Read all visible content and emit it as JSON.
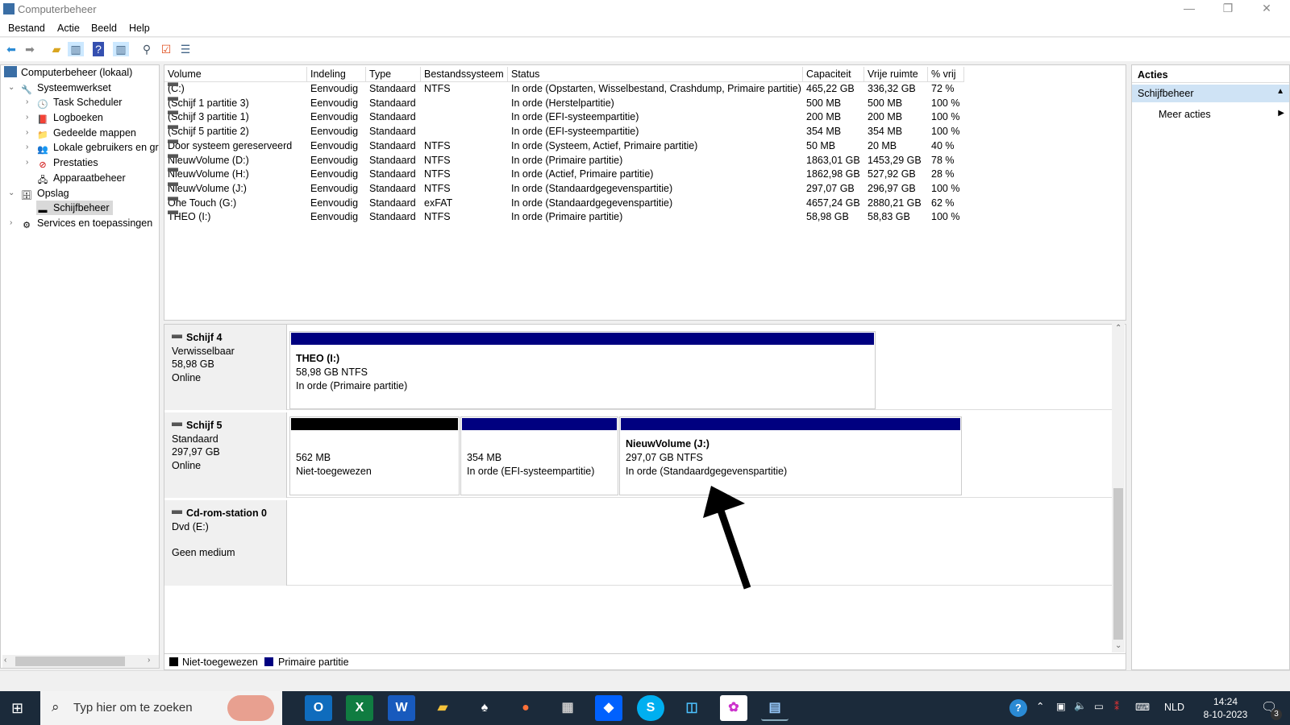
{
  "window": {
    "title": "Computerbeheer",
    "minimize": "—",
    "restore": "❐",
    "close": "✕"
  },
  "menu": [
    "Bestand",
    "Actie",
    "Beeld",
    "Help"
  ],
  "tree": {
    "root": "Computerbeheer (lokaal)",
    "items": [
      "Systeemwerkset",
      "Task Scheduler",
      "Logboeken",
      "Gedeelde mappen",
      "Lokale gebruikers en groepen",
      "Prestaties",
      "Apparaatbeheer",
      "Opslag",
      "Schijfbeheer",
      "Services en toepassingen"
    ]
  },
  "table": {
    "headers": [
      "Volume",
      "Indeling",
      "Type",
      "Bestandssysteem",
      "Status",
      "Capaciteit",
      "Vrije ruimte",
      "% vrij"
    ],
    "rows": [
      [
        "(C:)",
        "Eenvoudig",
        "Standaard",
        "NTFS",
        "In orde (Opstarten, Wisselbestand, Crashdump, Primaire partitie)",
        "465,22 GB",
        "336,32 GB",
        "72 %"
      ],
      [
        "(Schijf 1 partitie 3)",
        "Eenvoudig",
        "Standaard",
        "",
        "In orde (Herstelpartitie)",
        "500 MB",
        "500 MB",
        "100 %"
      ],
      [
        "(Schijf 3 partitie 1)",
        "Eenvoudig",
        "Standaard",
        "",
        "In orde (EFI-systeempartitie)",
        "200 MB",
        "200 MB",
        "100 %"
      ],
      [
        "(Schijf 5 partitie 2)",
        "Eenvoudig",
        "Standaard",
        "",
        "In orde (EFI-systeempartitie)",
        "354 MB",
        "354 MB",
        "100 %"
      ],
      [
        "Door systeem gereserveerd",
        "Eenvoudig",
        "Standaard",
        "NTFS",
        "In orde (Systeem, Actief, Primaire partitie)",
        "50 MB",
        "20 MB",
        "40 %"
      ],
      [
        "NieuwVolume (D:)",
        "Eenvoudig",
        "Standaard",
        "NTFS",
        "In orde (Primaire partitie)",
        "1863,01 GB",
        "1453,29 GB",
        "78 %"
      ],
      [
        "NieuwVolume (H:)",
        "Eenvoudig",
        "Standaard",
        "NTFS",
        "In orde (Actief, Primaire partitie)",
        "1862,98 GB",
        "527,92 GB",
        "28 %"
      ],
      [
        "NieuwVolume (J:)",
        "Eenvoudig",
        "Standaard",
        "NTFS",
        "In orde (Standaardgegevenspartitie)",
        "297,07 GB",
        "296,97 GB",
        "100 %"
      ],
      [
        "One Touch (G:)",
        "Eenvoudig",
        "Standaard",
        "exFAT",
        "In orde (Standaardgegevenspartitie)",
        "4657,24 GB",
        "2880,21 GB",
        "62 %"
      ],
      [
        "THEO (I:)",
        "Eenvoudig",
        "Standaard",
        "NTFS",
        "In orde (Primaire partitie)",
        "58,98 GB",
        "58,83 GB",
        "100 %"
      ]
    ]
  },
  "disks": [
    {
      "name": "Schijf 4",
      "type": "Verwisselbaar",
      "size": "58,98 GB",
      "state": "Online",
      "parts": [
        {
          "title": "THEO  (I:)",
          "line1": "58,98 GB NTFS",
          "line2": "In orde (Primaire partitie)"
        }
      ]
    },
    {
      "name": "Schijf 5",
      "type": "Standaard",
      "size": "297,97 GB",
      "state": "Online",
      "parts": [
        {
          "title": "",
          "line1": "562 MB",
          "line2": "Niet-toegewezen"
        },
        {
          "title": "",
          "line1": "354 MB",
          "line2": "In orde (EFI-systeempartitie)"
        },
        {
          "title": "NieuwVolume  (J:)",
          "line1": "297,07 GB NTFS",
          "line2": "In orde (Standaardgegevenspartitie)"
        }
      ]
    },
    {
      "name": "Cd-rom-station 0",
      "type": "Dvd (E:)",
      "size": "",
      "state": "Geen medium"
    }
  ],
  "legend": [
    "Niet-toegewezen",
    "Primaire partitie"
  ],
  "colors": {
    "unallocated": "#000000",
    "primary": "#000080",
    "selection": "#cce8ff"
  },
  "actions": {
    "title": "Acties",
    "section": "Schijfbeheer",
    "more": "Meer acties"
  },
  "taskbar": {
    "search_placeholder": "Typ hier om te zoeken",
    "lang": "NLD",
    "time": "14:24",
    "date": "8-10-2023",
    "notif_count": "3"
  }
}
